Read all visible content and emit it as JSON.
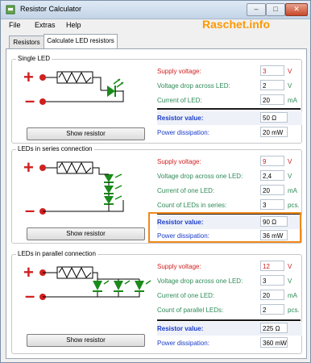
{
  "window": {
    "title": "Resistor Calculator",
    "minimize": "–",
    "maximize": "□",
    "close": "✕"
  },
  "menu": [
    "File",
    "Extras",
    "Help"
  ],
  "brand": "Raschet.info",
  "tabs": [
    "Resistors",
    "Calculate LED resistors"
  ],
  "single": {
    "title": "Single LED",
    "rows": [
      {
        "label": "Supply voltage:",
        "value": "3",
        "unit": "V"
      },
      {
        "label": "Voltage drop across LED:",
        "value": "2",
        "unit": "V"
      },
      {
        "label": "Current of LED:",
        "value": "20",
        "unit": "mA"
      }
    ],
    "result_label": "Resistor value:",
    "result_value": "50 Ω",
    "power_label": "Power dissipation:",
    "power_value": "20 mW",
    "button": "Show resistor"
  },
  "series": {
    "title": "LEDs in series connection",
    "rows": [
      {
        "label": "Supply voltage:",
        "value": "9",
        "unit": "V"
      },
      {
        "label": "Voltage drop across one LED:",
        "value": "2,4",
        "unit": "V"
      },
      {
        "label": "Current of one LED:",
        "value": "20",
        "unit": "mA"
      },
      {
        "label": "Count of LEDs in series:",
        "value": "3",
        "unit": "pcs."
      }
    ],
    "result_label": "Resistor value:",
    "result_value": "90 Ω",
    "power_label": "Power dissipation:",
    "power_value": "36 mW",
    "button": "Show resistor"
  },
  "parallel": {
    "title": "LEDs in parallel connection",
    "rows": [
      {
        "label": "Supply voltage:",
        "value": "12",
        "unit": "V"
      },
      {
        "label": "Voltage drop across one LED:",
        "value": "3",
        "unit": "V"
      },
      {
        "label": "Current of one LED:",
        "value": "20",
        "unit": "mA"
      },
      {
        "label": "Count of parallel LEDs:",
        "value": "2",
        "unit": "pcs."
      }
    ],
    "result_label": "Resistor value:",
    "result_value": "225 Ω",
    "power_label": "Power dissipation:",
    "power_value": "360 mW",
    "button": "Show resistor"
  },
  "colors": {
    "accent_orange": "#f08a1c",
    "label_green": "#2e8b57",
    "label_red": "#d02020",
    "label_blue": "#1a3cc8",
    "led_green": "#1a8a1a"
  }
}
